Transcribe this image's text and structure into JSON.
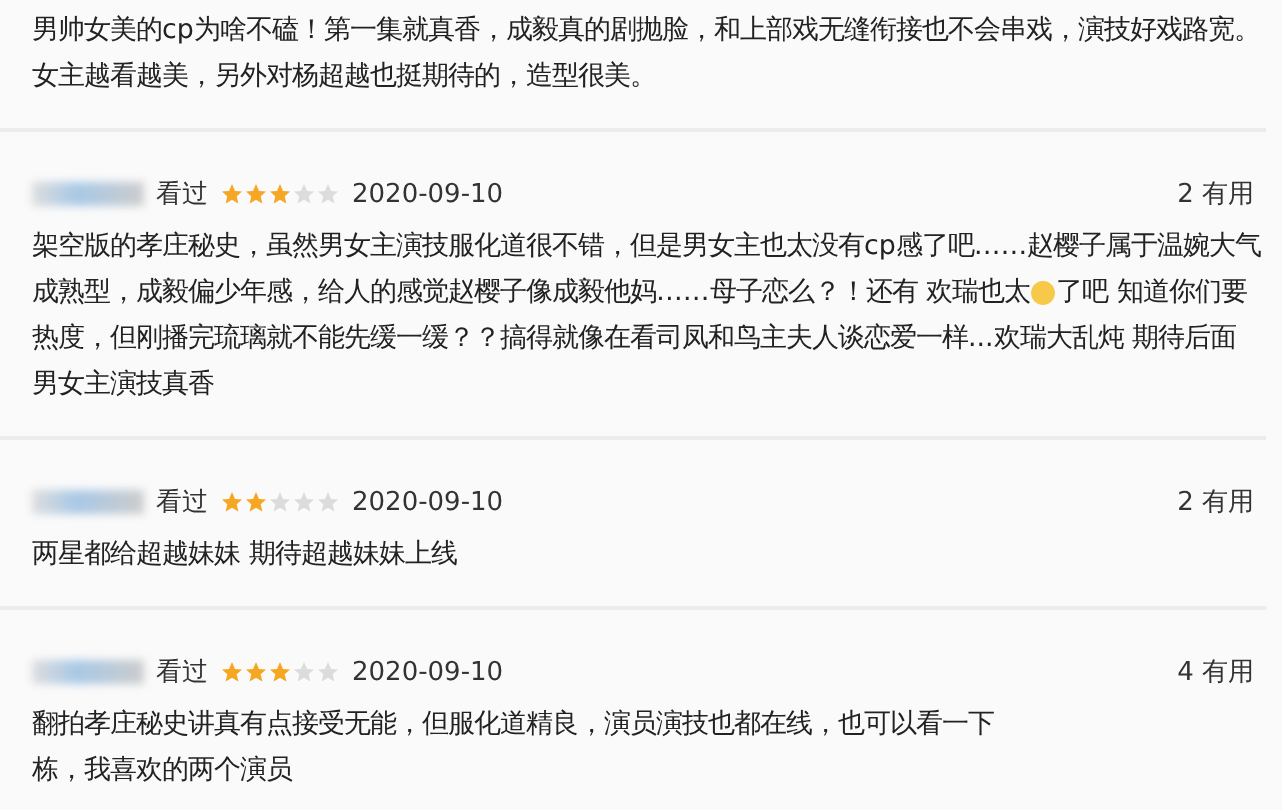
{
  "reviews": [
    {
      "lines": [
        {
          "kind": "text",
          "text": "男帅女美的cp为啥不磕！第一集就真香，成毅真的剧抛脸，和上部戏无缝衔接也不会串戏，演技好戏路宽。"
        },
        {
          "kind": "text",
          "text": "女主越看越美，另外对杨超越也挺期待的，造型很美。"
        }
      ]
    },
    {
      "watched": "看过",
      "stars": 3,
      "date": "2020-09-10",
      "useful": "2 有用",
      "lines": [
        {
          "kind": "text",
          "text": "架空版的孝庄秘史，虽然男女主演技服化道很不错，但是男女主也太没有cp感了吧……赵樱子属于温婉大气"
        },
        {
          "kind": "emoji",
          "text": "成熟型，成毅偏少年感，给人的感觉赵樱子像成毅他妈……母子恋么？！还有 欢瑞也太",
          "after": "了吧 知道你们要"
        },
        {
          "kind": "text",
          "text": "热度，但刚播完琉璃就不能先缓一缓？？搞得就像在看司凤和鸟主夫人谈恋爱一样...欢瑞大乱炖 期待后面"
        },
        {
          "kind": "text",
          "text": "男女主演技真香"
        }
      ]
    },
    {
      "watched": "看过",
      "stars": 2,
      "date": "2020-09-10",
      "useful": "2 有用",
      "lines": [
        {
          "kind": "text",
          "text": "两星都给超越妹妹 期待超越妹妹上线"
        }
      ]
    },
    {
      "watched": "看过",
      "stars": 3,
      "date": "2020-09-10",
      "useful": "4 有用",
      "lines": [
        {
          "kind": "text",
          "text": "翻拍孝庄秘史讲真有点接受无能，但服化道精良，演员演技也都在线，也可以看一下"
        },
        {
          "kind": "text",
          "text": "栋，我喜欢的两个演员"
        }
      ]
    }
  ]
}
